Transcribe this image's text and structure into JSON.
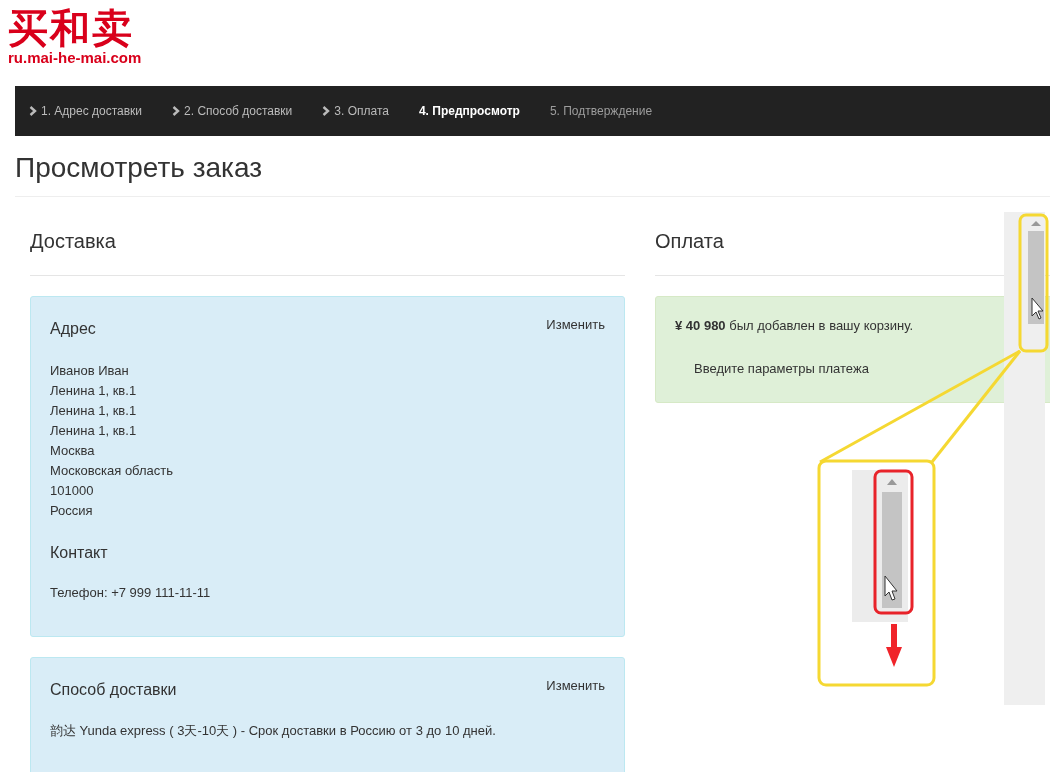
{
  "logo": {
    "mark": "买和卖",
    "domain": "ru.mai-he-mai.com"
  },
  "steps": [
    {
      "label": "1. Адрес доставки",
      "selected": false,
      "completed": true
    },
    {
      "label": "2. Способ доставки",
      "selected": false,
      "completed": true
    },
    {
      "label": "3. Оплата",
      "selected": false,
      "completed": true
    },
    {
      "label": "4. Предпросмотр",
      "selected": true,
      "completed": false
    },
    {
      "label": "5. Подтверждение",
      "selected": false,
      "completed": false
    }
  ],
  "page_title": "Просмотреть заказ",
  "delivery": {
    "heading": "Доставка",
    "address_panel": {
      "title": "Адрес",
      "edit_link": "Изменить",
      "lines": [
        "Иванов Иван",
        "Ленина 1, кв.1",
        "Ленина 1, кв.1",
        "Ленина 1, кв.1",
        "Москва",
        "Московская область",
        "101000",
        "Россия"
      ],
      "contact_title": "Контакт",
      "phone": "Телефон: +7 999 111-11-11"
    },
    "method_panel": {
      "title": "Способ доставки",
      "edit_link": "Изменить",
      "text": "韵达 Yunda express ( 3天-10天 ) - Срок доставки в Россию от 3 до 10 дней."
    }
  },
  "payment": {
    "heading": "Оплата",
    "message": "**¥ 40 980** был добавлен в вашу корзину.",
    "prompt": "Введите параметры платежа"
  }
}
